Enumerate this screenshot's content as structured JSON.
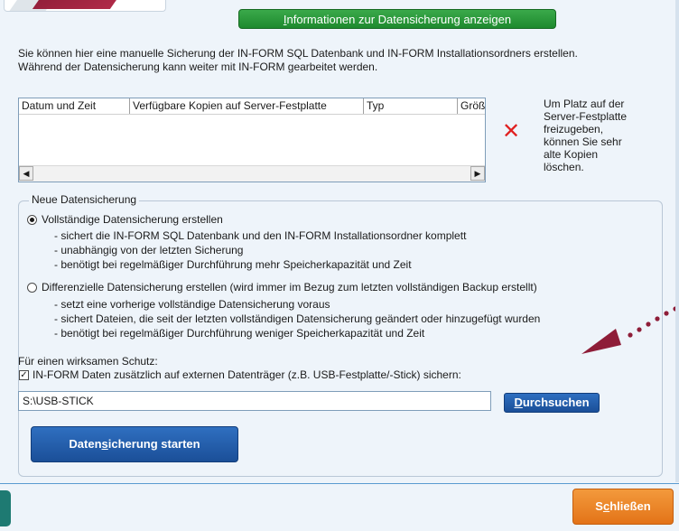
{
  "header": {
    "info_button": {
      "pre": "",
      "accel": "I",
      "post": "nformationen zur Datensicherung anzeigen"
    }
  },
  "description": {
    "line1": "Sie können hier eine manuelle Sicherung der IN-FORM SQL Datenbank und IN-FORM Installationsordners erstellen.",
    "line2": "Während der Datensicherung kann weiter mit IN-FORM gearbeitet werden."
  },
  "copies_table": {
    "columns": [
      "Datum und Zeit",
      "Verfügbare Kopien auf Server-Festplatte",
      "Typ",
      "Größe"
    ],
    "rows": []
  },
  "delete_hint": {
    "lines": [
      "Um Platz auf der",
      "Server-Festplatte",
      "freizugeben,",
      "können Sie sehr",
      "alte Kopien",
      "löschen."
    ]
  },
  "new_backup": {
    "legend": "Neue Datensicherung",
    "full": {
      "label": "Vollständige Datensicherung erstellen",
      "selected": true,
      "notes": [
        "- sichert die IN-FORM SQL Datenbank und den IN-FORM Installationsordner komplett",
        "- unabhängig von der letzten Sicherung",
        "- benötigt bei regelmäßiger Durchführung mehr Speicherkapazität und Zeit"
      ]
    },
    "differential": {
      "label": "Differenzielle Datensicherung erstellen (wird immer im Bezug zum letzten vollständigen Backup erstellt)",
      "selected": false,
      "notes": [
        "- setzt eine vorherige vollständige Datensicherung voraus",
        "- sichert Dateien, die seit der letzten vollständigen Datensicherung geändert oder hinzugefügt wurden",
        "- benötigt bei regelmäßiger Durchführung weniger Speicherkapazität und Zeit"
      ]
    },
    "protection_label": "Für einen wirksamen Schutz:",
    "external_checkbox": {
      "label": "IN-FORM Daten zusätzlich auf externen Datenträger (z.B. USB-Festplatte/-Stick) sichern:",
      "checked": true
    },
    "path_value": "S:\\USB-STICK",
    "browse_button": {
      "pre": "",
      "accel": "D",
      "post": "urchsuchen"
    },
    "start_button": {
      "pre": "Daten",
      "accel": "s",
      "post": "icherung starten"
    }
  },
  "footer": {
    "close_button": {
      "pre": "S",
      "accel": "c",
      "post": "hließen"
    }
  },
  "colors": {
    "background": "#eef4fa",
    "info_button": "#2a9a3b",
    "primary_button": "#1f5aa6",
    "close_button": "#ea7d22",
    "delete_icon": "#e02020",
    "annotation_arrow": "#8e1d38"
  }
}
